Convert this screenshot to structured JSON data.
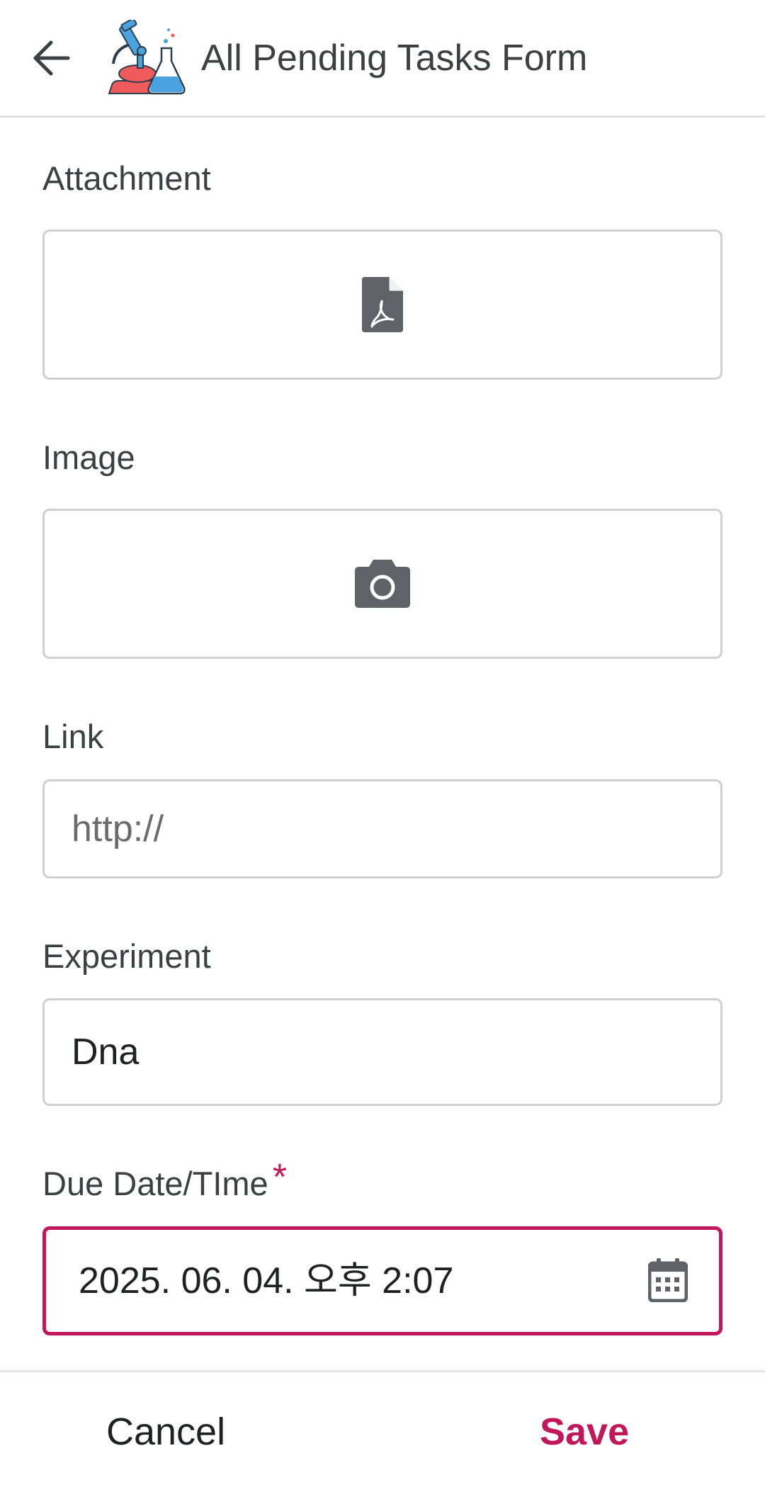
{
  "header": {
    "title": "All Pending Tasks Form",
    "back_icon": "arrow-left-icon",
    "logo_icon": "microscope-flask-icon"
  },
  "form": {
    "attachment": {
      "label": "Attachment",
      "icon": "pdf-file-icon"
    },
    "image": {
      "label": "Image",
      "icon": "camera-icon"
    },
    "link": {
      "label": "Link",
      "placeholder": "http://",
      "value": ""
    },
    "experiment": {
      "label": "Experiment",
      "value": "Dna"
    },
    "due_datetime": {
      "label": "Due Date/TIme",
      "required_marker": "*",
      "value": "2025. 06. 04. 오후 2:07",
      "icon": "calendar-icon"
    }
  },
  "actions": {
    "cancel_label": "Cancel",
    "save_label": "Save"
  },
  "colors": {
    "accent": "#c2185b",
    "border": "#cfcfcf",
    "icon_gray": "#5f6368",
    "text": "#3c4043"
  }
}
